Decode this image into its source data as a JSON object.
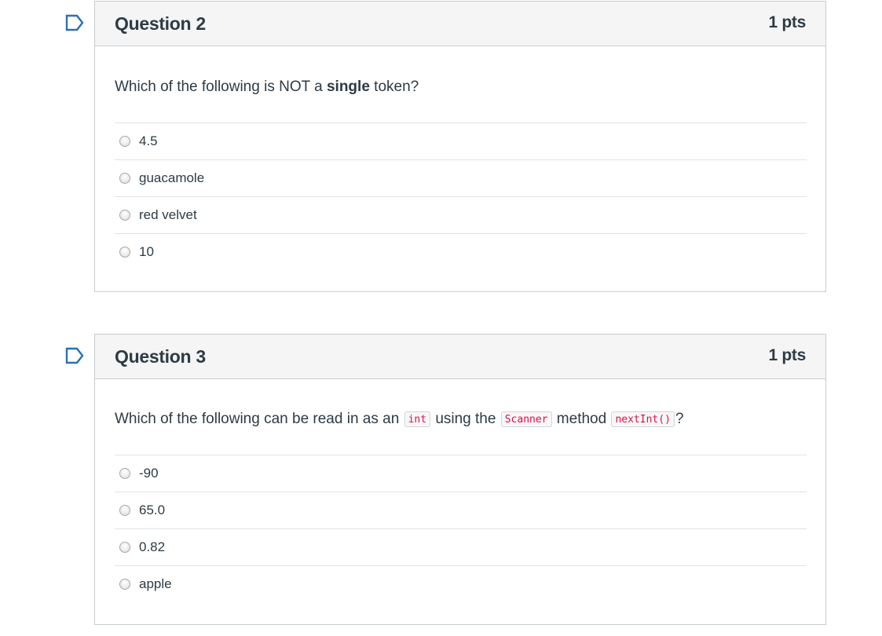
{
  "questions": [
    {
      "title": "Question 2",
      "points": "1 pts",
      "text_parts": {
        "before": "Which of the following is NOT a ",
        "bold": "single",
        "after": " token?"
      },
      "answers": [
        "4.5",
        "guacamole",
        "red velvet",
        "10"
      ]
    },
    {
      "title": "Question 3",
      "points": "1 pts",
      "text_parts": {
        "p1": "Which of the following can be read in as an ",
        "code1": "int",
        "p2": " using the ",
        "code2": "Scanner",
        "p3": " method ",
        "code3": "nextInt()",
        "p4": "?"
      },
      "answers": [
        "-90",
        "65.0",
        "0.82",
        "apple"
      ]
    }
  ],
  "icons": {
    "flag": "bookmark-flag-icon",
    "radio": "radio-button-unselected"
  },
  "colors": {
    "header_bg": "#f5f5f5",
    "border": "#c7cdd1",
    "text": "#2d3b45",
    "code_text": "#dd1144"
  }
}
